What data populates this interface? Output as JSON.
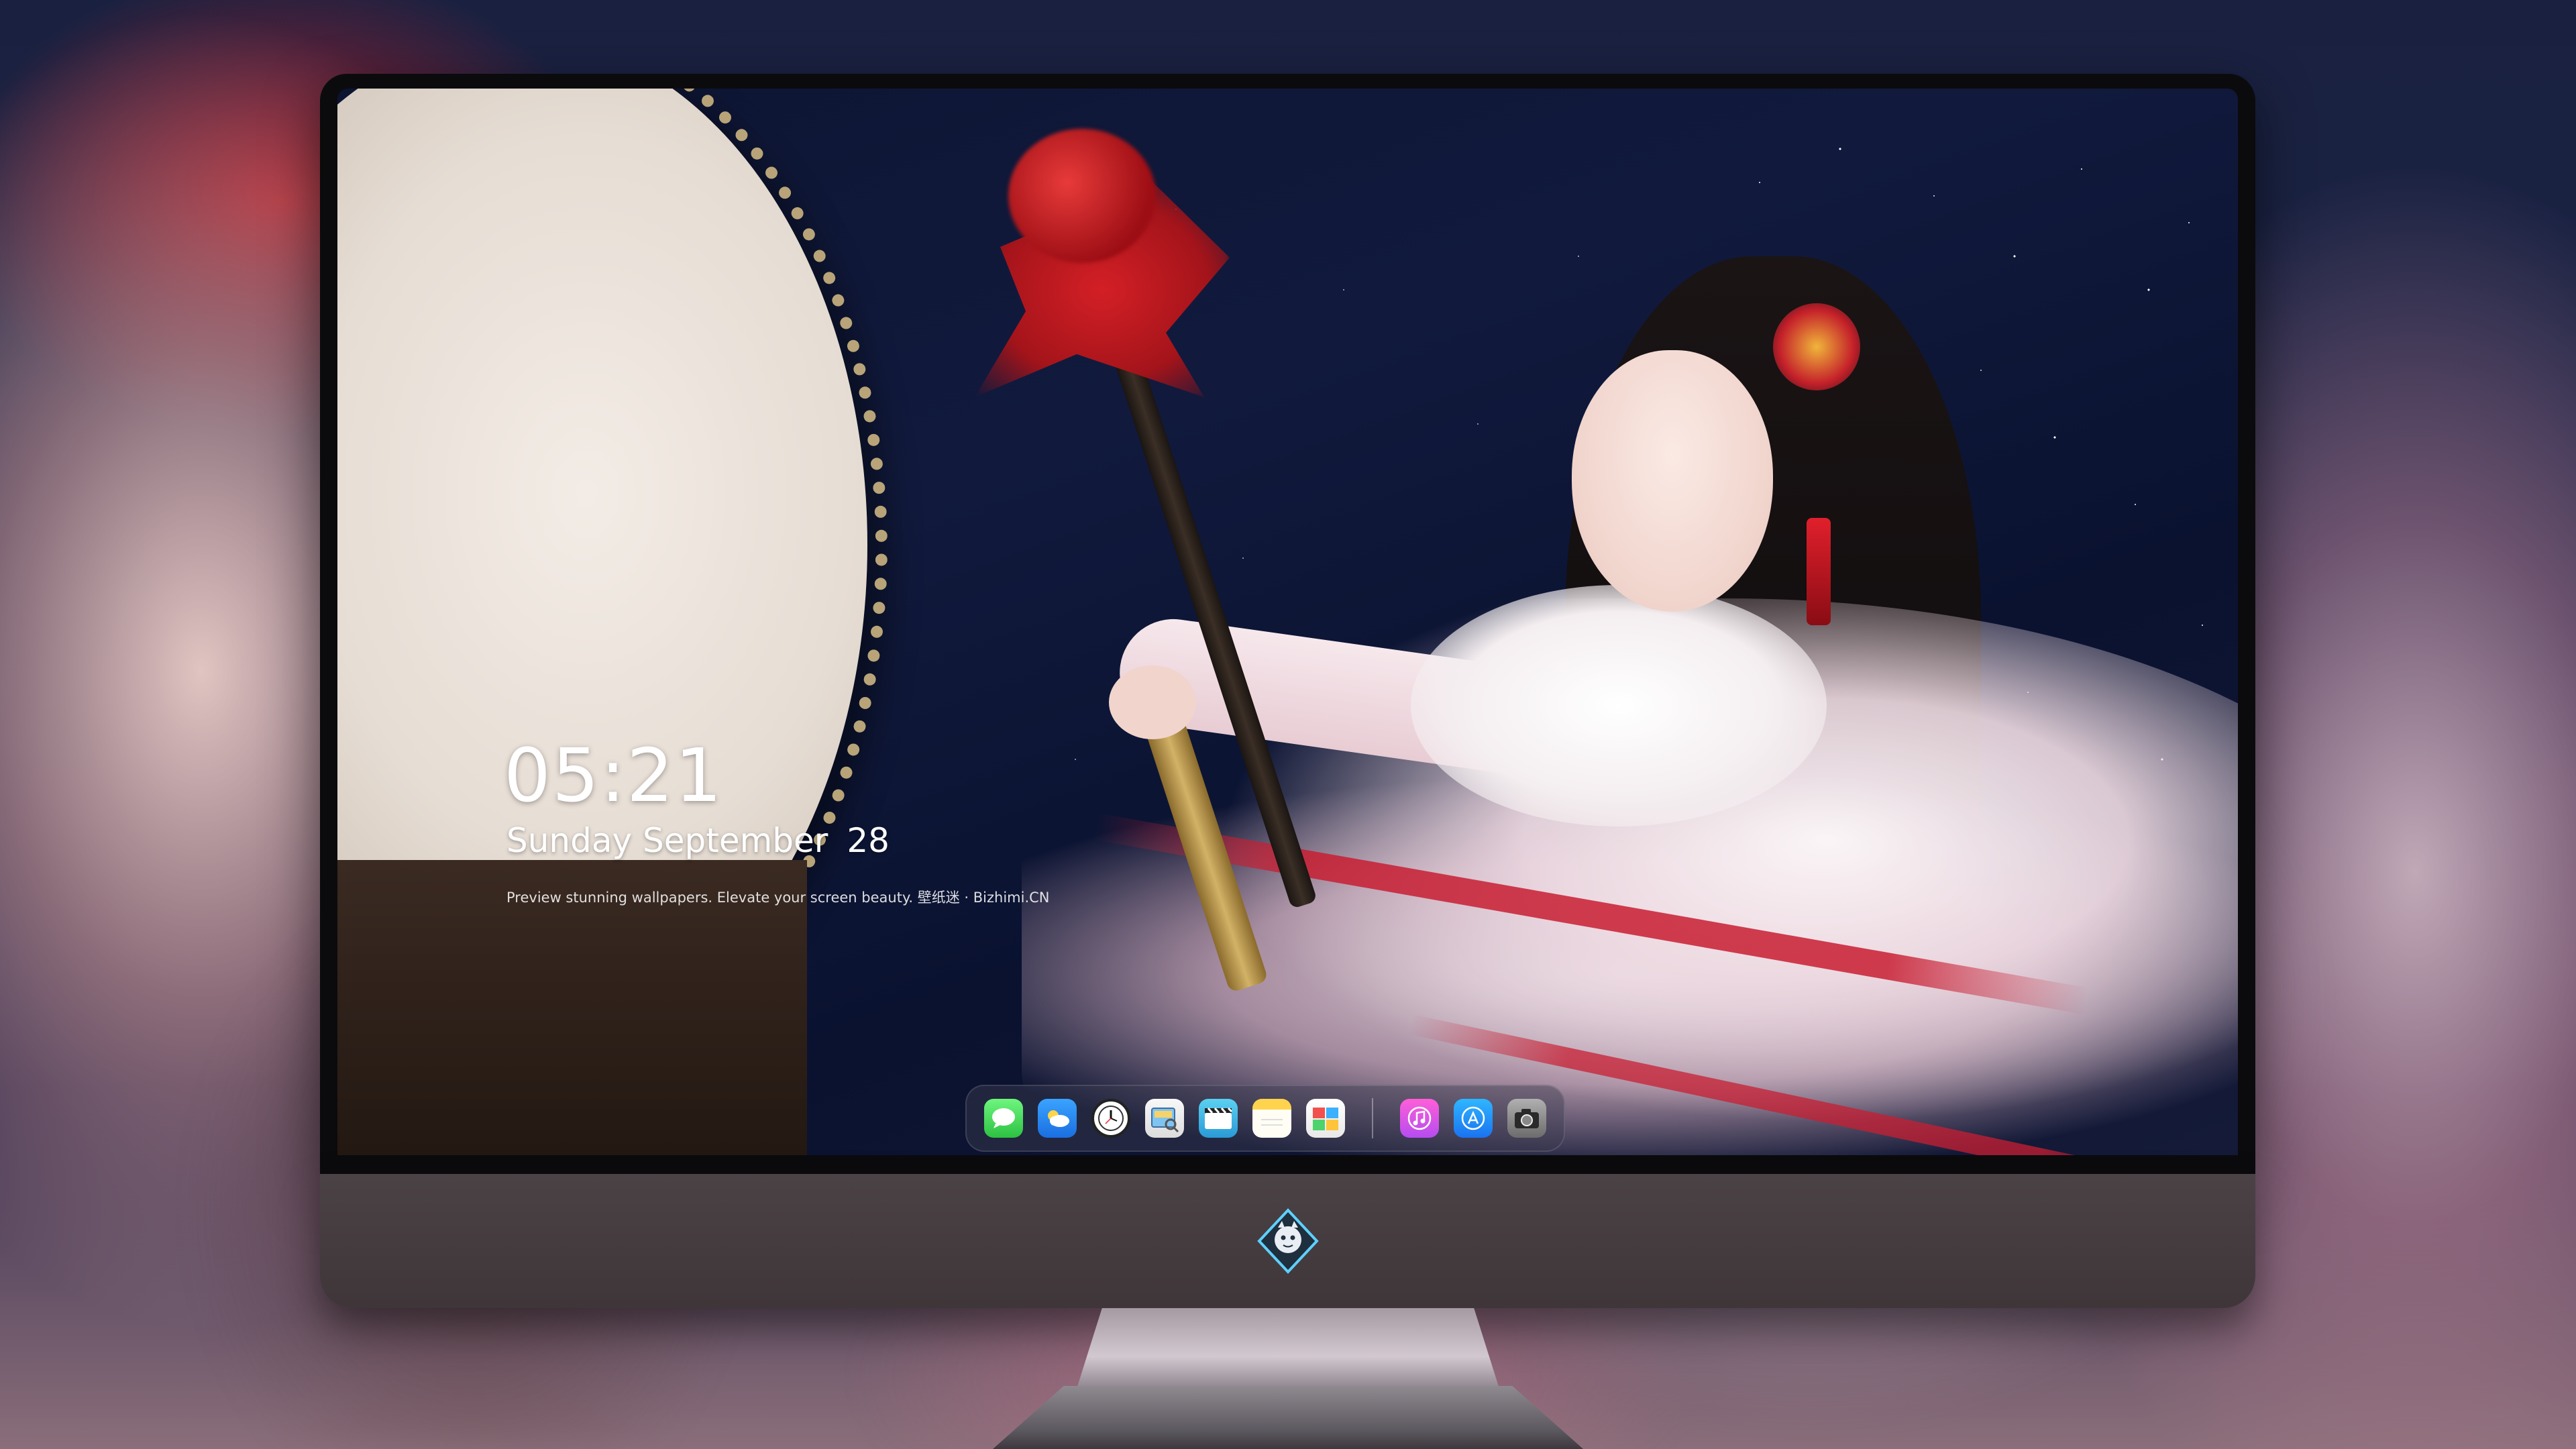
{
  "lockscreen": {
    "time": "05:21",
    "weekday_month": "Sunday September",
    "day": "28",
    "tagline": "Preview stunning wallpapers. Elevate your screen beauty. 壁纸迷 · Bizhimi.CN"
  },
  "dock": {
    "apps": [
      {
        "icon": "messages-icon"
      },
      {
        "icon": "weather-icon"
      },
      {
        "icon": "clock-icon"
      },
      {
        "icon": "preview-icon"
      },
      {
        "icon": "video-icon"
      },
      {
        "icon": "notes-icon"
      },
      {
        "icon": "photos-icon"
      },
      {
        "icon": "music-icon"
      },
      {
        "icon": "app-store-icon"
      },
      {
        "icon": "camera-icon"
      }
    ]
  },
  "colors": {
    "bezel": "#0b0b0d",
    "chin": "#4b4246",
    "text": "#ffffff"
  }
}
